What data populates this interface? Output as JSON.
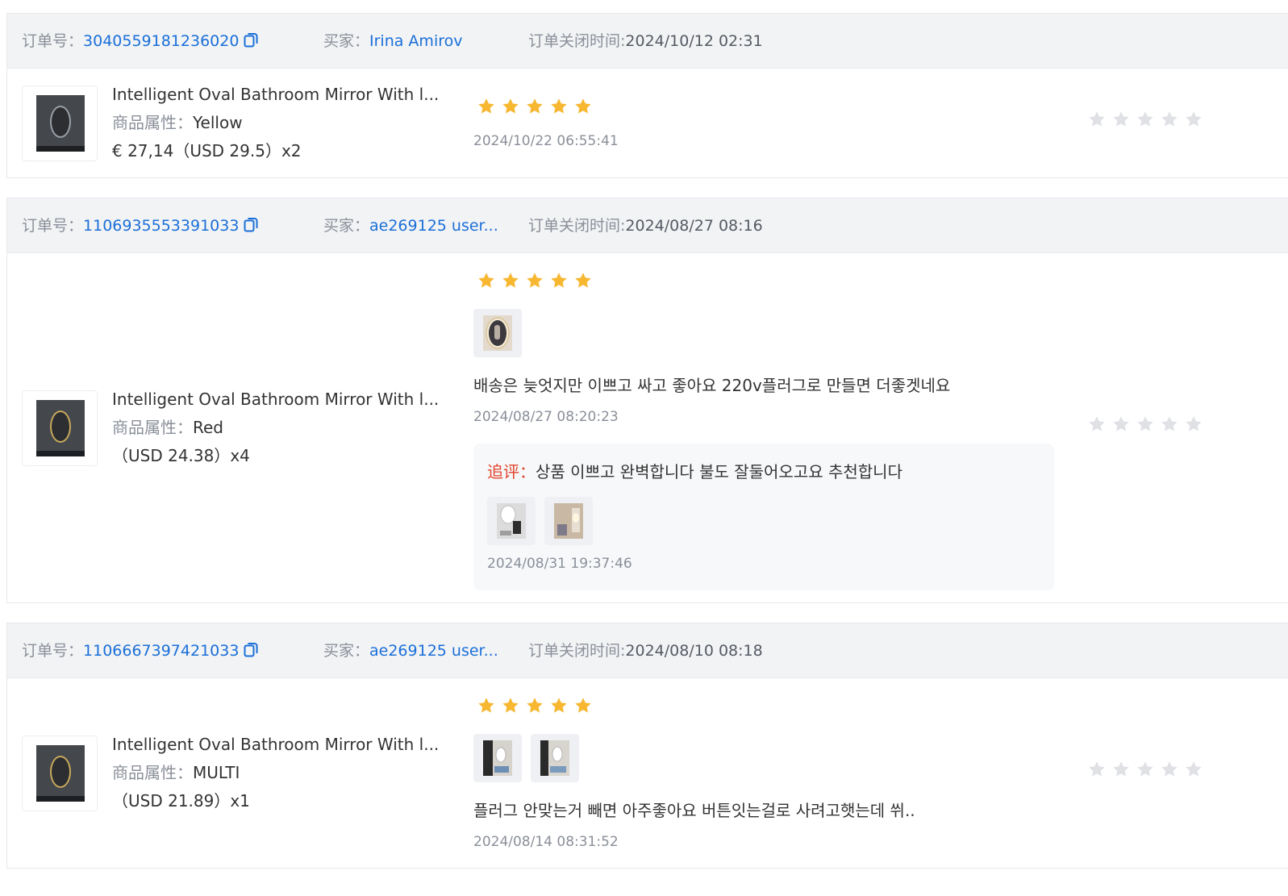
{
  "labels": {
    "order_no": "订单号：",
    "buyer": "买家：",
    "close_time": "订单关闭时间:",
    "attr": "商品属性：",
    "followup": "追评："
  },
  "colors": {
    "link": "#1a6fd8",
    "star_active": "#f7b731",
    "star_inactive": "#dfe1e5",
    "followup_label": "#e2432a",
    "header_bg": "#f2f3f5"
  },
  "orders": [
    {
      "order_no": "3040559181236020",
      "buyer": "Irina Amirov",
      "close_time": "2024/10/12 02:31",
      "product": {
        "title": "Intelligent Oval Bathroom Mirror With l...",
        "attr_value": "Yellow",
        "price": "€ 27,14（USD  29.5）x2",
        "thumb_icon": "oval-mirror-thumbnail"
      },
      "review": {
        "rating": 5,
        "text": "",
        "time": "2024/10/22 06:55:41",
        "photos": []
      },
      "reply_rating": 0
    },
    {
      "order_no": "1106935553391033",
      "buyer": "ae269125 user...",
      "close_time": "2024/08/27 08:16",
      "product": {
        "title": "Intelligent Oval Bathroom Mirror With l...",
        "attr_value": "Red",
        "price": "（USD  24.38）x4",
        "thumb_icon": "oval-mirror-thumbnail"
      },
      "review": {
        "rating": 5,
        "photos": [
          "oval-mirror-photo"
        ],
        "text": "배송은 늦엇지만 이쁘고 싸고 좋아요 220v플러그로 만들면 더좋겟네요",
        "time": "2024/08/27 08:20:23",
        "followup": {
          "text": "상품 이쁘고 완벽합니다 불도 잘둘어오고요 추천합니다",
          "photos": [
            "mirror-on-wall-photo",
            "bathroom-mirror-photo"
          ],
          "time": "2024/08/31 19:37:46"
        }
      },
      "reply_rating": 0
    },
    {
      "order_no": "1106667397421033",
      "buyer": "ae269125 user...",
      "close_time": "2024/08/10 08:18",
      "product": {
        "title": "Intelligent Oval Bathroom Mirror With l...",
        "attr_value": "MULTI",
        "price": "（USD  21.89）x1",
        "thumb_icon": "oval-mirror-thumbnail"
      },
      "review": {
        "rating": 5,
        "photos": [
          "vanity-mirror-photo",
          "vanity-mirror-photo-2"
        ],
        "text": "플러그 안맞는거 빼면 아주좋아요 버튼잇는걸로 사려고햇는데 쒸..",
        "time": "2024/08/14 08:31:52"
      },
      "reply_rating": 0
    }
  ]
}
